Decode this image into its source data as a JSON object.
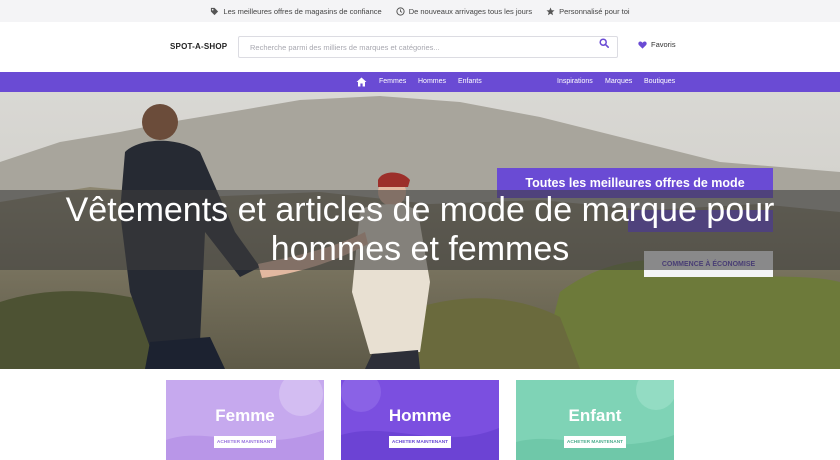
{
  "topbar": {
    "items": [
      {
        "icon": "tag-icon",
        "label": "Les meilleures offres de magasins de confiance"
      },
      {
        "icon": "clock-icon",
        "label": "De nouveaux arrivages tous les jours"
      },
      {
        "icon": "star-icon",
        "label": "Personnalisé pour toi"
      }
    ]
  },
  "header": {
    "logo": "SPOT-A-SHOP",
    "search_placeholder": "Recherche parmi des milliers de marques et catégories...",
    "search_icon": "search-icon",
    "favorites_label": "Favoris",
    "favorites_icon": "heart-icon"
  },
  "nav": {
    "home_icon": "home-icon",
    "left": [
      "Femmes",
      "Hommes",
      "Enfants"
    ],
    "right": [
      "Inspirations",
      "Marques",
      "Boutiques"
    ]
  },
  "hero": {
    "headline": "Vêtements et articles de mode de marque pour hommes et femmes",
    "promo_title": "Toutes les meilleures offres de mode",
    "promo_button": "COMMENCE À ÉCONOMISE"
  },
  "categories": [
    {
      "title": "Femme",
      "button": "ACHETER MAINTENANT"
    },
    {
      "title": "Homme",
      "button": "ACHETER MAINTENANT"
    },
    {
      "title": "Enfant",
      "button": "ACHETER MAINTENANT"
    }
  ],
  "colors": {
    "brand_purple": "#6a4bd4",
    "card_femme": "#c6a9ee",
    "card_homme": "#7b4fe0",
    "card_enfant": "#7fd3b6"
  }
}
